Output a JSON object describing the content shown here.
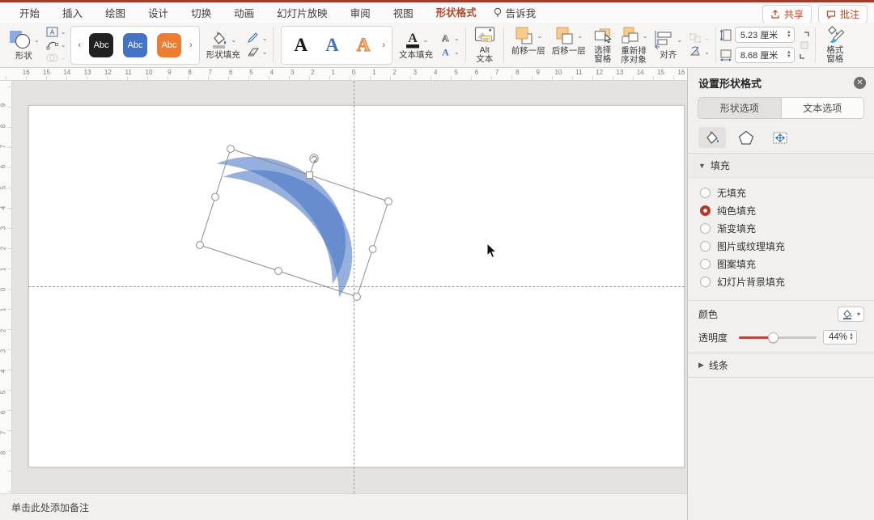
{
  "menu": {
    "tabs": [
      "开始",
      "插入",
      "绘图",
      "设计",
      "切换",
      "动画",
      "幻灯片放映",
      "审阅",
      "视图",
      "形状格式"
    ],
    "active_tab": "形状格式",
    "tell_me": "告诉我",
    "share_label": "共享",
    "comments_label": "批注"
  },
  "ribbon": {
    "shapes_label": "形状",
    "style_chips": [
      "Abc",
      "Abc",
      "Abc"
    ],
    "shape_fill_label": "形状填充",
    "wordart_letters": [
      "A",
      "A",
      "A"
    ],
    "text_fill_label": "文本填充",
    "alt_text_label": "Alt\n文本",
    "bring_forward_label": "前移一层",
    "send_backward_label": "后移一层",
    "selection_pane_label": "选择\n窗格",
    "reorder_objects_label": "重新排\n序对象",
    "align_label": "对齐",
    "format_pane_label": "格式\n窗格",
    "size": {
      "height_value": "5.23",
      "height_unit": "厘米",
      "width_value": "8.68",
      "width_unit": "厘米"
    }
  },
  "panel": {
    "title": "设置形状格式",
    "tabs": [
      "形状选项",
      "文本选项"
    ],
    "fill": {
      "header": "填充",
      "options": [
        {
          "label": "无填充",
          "selected": false
        },
        {
          "label": "纯色填充",
          "selected": true
        },
        {
          "label": "渐变填充",
          "selected": false
        },
        {
          "label": "图片或纹理填充",
          "selected": false
        },
        {
          "label": "图案填充",
          "selected": false
        },
        {
          "label": "幻灯片背景填充",
          "selected": false
        }
      ],
      "color_label": "颜色",
      "transparency_label": "透明度",
      "transparency_value": "44%",
      "transparency_percent": 44
    },
    "line_header": "线条"
  },
  "canvas": {
    "notes_placeholder": "单击此处添加备注",
    "shape_fill_color": "#4472C4",
    "shape_opacity": 0.56
  },
  "rulers": {
    "h": {
      "numbers": [
        16,
        15,
        14,
        13,
        12,
        11,
        10,
        9,
        8,
        7,
        6,
        5,
        4,
        3,
        2,
        1,
        0,
        1,
        2,
        3,
        4,
        5,
        6,
        7,
        8,
        9,
        10,
        11,
        12,
        13,
        14,
        15,
        16
      ],
      "center": 437,
      "spacing": 25.3
    },
    "v": {
      "numbers": [
        9,
        8,
        7,
        6,
        5,
        4,
        3,
        2,
        1,
        0,
        1,
        2,
        3,
        4,
        5,
        6,
        7,
        8
      ],
      "center": 258,
      "spacing": 25.3
    }
  },
  "colors": {
    "accent_red": "#b7472a",
    "chip_black": "#212121",
    "chip_blue": "#4472c4",
    "chip_orange": "#ed7d31"
  }
}
